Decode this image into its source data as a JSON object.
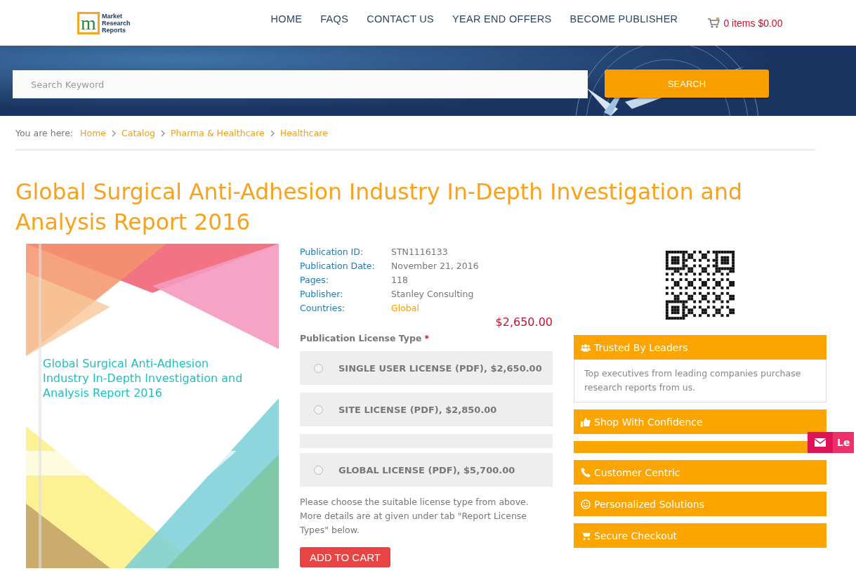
{
  "header": {
    "logo": {
      "letter": "m",
      "lines": [
        "Market",
        "Research",
        "Reports"
      ]
    },
    "nav": [
      "HOME",
      "FAQS",
      "CONTACT US",
      "YEAR END OFFERS",
      "BECOME PUBLISHER"
    ],
    "cart": "0 items $0.00"
  },
  "search": {
    "placeholder": "Search Keyword",
    "button": "SEARCH"
  },
  "breadcrumb": {
    "label": "You are here:",
    "items": [
      "Home",
      "Catalog",
      "Pharma & Healthcare",
      "Healthcare"
    ]
  },
  "title": "Global Surgical Anti-Adhesion Industry In-Depth Investigation and Analysis Report 2016",
  "cover": {
    "title": "Global Surgical Anti-Adhesion Industry In-Depth Investigation and Analysis Report 2016"
  },
  "details": [
    {
      "label": "Publication ID:",
      "value": "STN1116133",
      "kind": "plain"
    },
    {
      "label": "Publication Date:",
      "value": "November 21, 2016",
      "kind": "plain"
    },
    {
      "label": "Pages:",
      "value": "118",
      "kind": "plain"
    },
    {
      "label": "Publisher:",
      "value": "Stanley Consulting",
      "kind": "plain"
    },
    {
      "label": "Countries:",
      "value": "Global",
      "kind": "link"
    }
  ],
  "price": "$2,650.00",
  "license": {
    "label": "Publication License Type",
    "required": "*",
    "options": [
      {
        "kind": "option",
        "label": "SINGLE USER LICENSE (PDF), $2,650.00",
        "selected": false
      },
      {
        "kind": "option",
        "label": "SITE LICENSE (PDF), $2,850.00",
        "selected": false
      },
      {
        "kind": "clipped"
      },
      {
        "kind": "option",
        "label": "GLOBAL LICENSE (PDF), $5,700.00",
        "selected": false
      }
    ]
  },
  "note": "Please choose the suitable license type from above. More details are at given under tab \"Report License Types\" below.",
  "add_to_cart": "ADD TO CART",
  "sidebar": [
    {
      "kind": "panel",
      "title": "Trusted By Leaders",
      "body": "Top executives from leading companies purchase research reports from us."
    },
    {
      "kind": "panel",
      "title": "Shop With Confidence"
    },
    {
      "kind": "clipped"
    },
    {
      "kind": "panel",
      "title": "Customer Centric"
    },
    {
      "kind": "panel",
      "title": "Personalized Solutions"
    },
    {
      "kind": "panel",
      "title": "Secure Checkout"
    }
  ],
  "feedback_tab": "Le"
}
